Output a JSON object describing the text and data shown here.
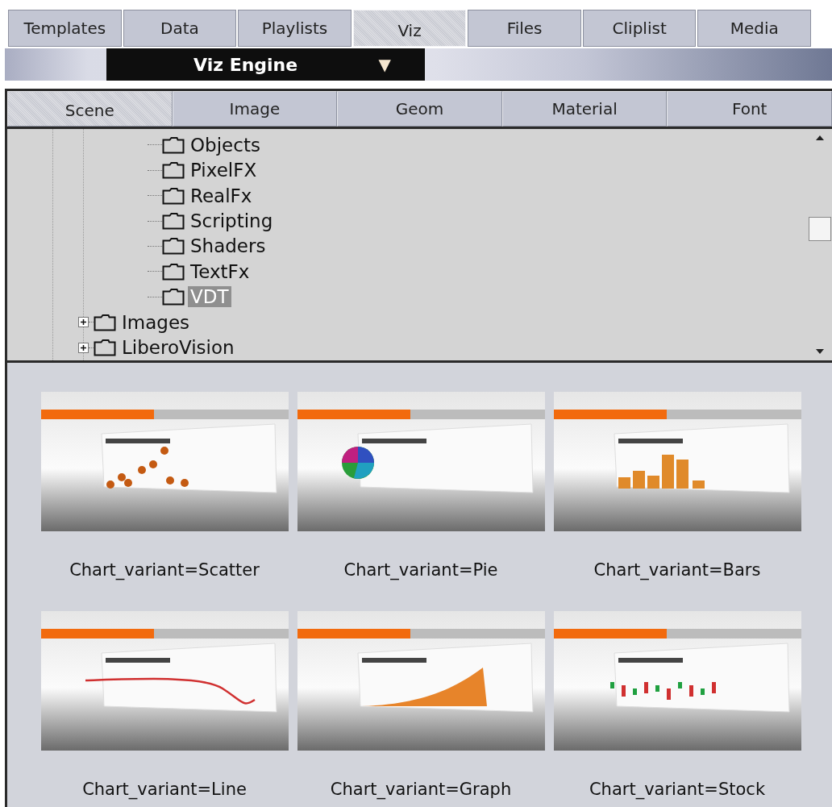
{
  "tabs": [
    {
      "label": "Templates",
      "selected": false
    },
    {
      "label": "Data",
      "selected": false
    },
    {
      "label": "Playlists",
      "selected": false
    },
    {
      "label": "Viz",
      "selected": true
    },
    {
      "label": "Files",
      "selected": false
    },
    {
      "label": "Cliplist",
      "selected": false
    },
    {
      "label": "Media",
      "selected": false
    }
  ],
  "engine_selector": {
    "value": "Viz Engine",
    "caret": "▼"
  },
  "subtabs": [
    {
      "label": "Scene",
      "selected": true
    },
    {
      "label": "Image",
      "selected": false
    },
    {
      "label": "Geom",
      "selected": false
    },
    {
      "label": "Material",
      "selected": false
    },
    {
      "label": "Font",
      "selected": false
    }
  ],
  "tree": {
    "open_branch": [
      {
        "label": "Objects",
        "selected": false
      },
      {
        "label": "PixelFX",
        "selected": false
      },
      {
        "label": "RealFx",
        "selected": false
      },
      {
        "label": "Scripting",
        "selected": false
      },
      {
        "label": "Shaders",
        "selected": false
      },
      {
        "label": "TextFx",
        "selected": false
      },
      {
        "label": "VDT",
        "selected": true
      }
    ],
    "items": [
      {
        "label": "Images",
        "expanded": false,
        "selected": false
      },
      {
        "label": "LiberoVision",
        "expanded": false,
        "selected": false
      }
    ]
  },
  "thumbnails": [
    {
      "kind": "scatter",
      "label": "Chart_variant=Scatter"
    },
    {
      "kind": "pie",
      "label": "Chart_variant=Pie"
    },
    {
      "kind": "bars",
      "label": "Chart_variant=Bars"
    },
    {
      "kind": "line",
      "label": "Chart_variant=Line"
    },
    {
      "kind": "graph",
      "label": "Chart_variant=Graph"
    },
    {
      "kind": "stock",
      "label": "Chart_variant=Stock"
    }
  ]
}
